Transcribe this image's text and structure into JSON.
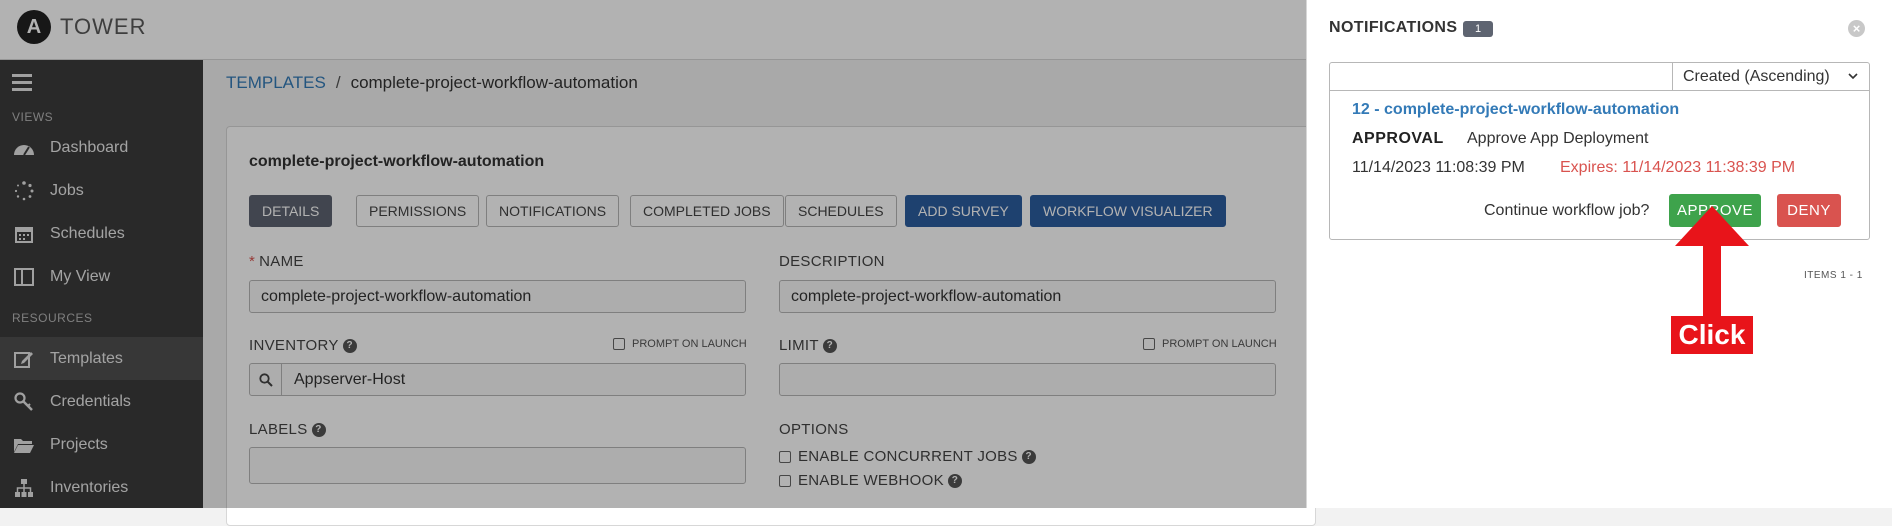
{
  "app": {
    "logo_letter": "A",
    "name": "TOWER"
  },
  "sidebar": {
    "sections": {
      "views": "VIEWS",
      "resources": "RESOURCES"
    },
    "items": [
      {
        "label": "Dashboard",
        "icon": "dashboard-icon"
      },
      {
        "label": "Jobs",
        "icon": "jobs-spinner-icon"
      },
      {
        "label": "Schedules",
        "icon": "calendar-icon"
      },
      {
        "label": "My View",
        "icon": "columns-icon"
      },
      {
        "label": "Templates",
        "icon": "pencil-square-icon",
        "active": true
      },
      {
        "label": "Credentials",
        "icon": "key-icon"
      },
      {
        "label": "Projects",
        "icon": "folder-icon"
      },
      {
        "label": "Inventories",
        "icon": "sitemap-icon"
      }
    ]
  },
  "breadcrumb": {
    "root": "TEMPLATES",
    "separator": "/",
    "current": "complete-project-workflow-automation"
  },
  "template": {
    "title": "complete-project-workflow-automation",
    "tabs": {
      "details": "DETAILS",
      "permissions": "PERMISSIONS",
      "notifications": "NOTIFICATIONS",
      "completed_jobs": "COMPLETED JOBS",
      "schedules": "SCHEDULES",
      "add_survey": "ADD SURVEY",
      "workflow_visualizer": "WORKFLOW VISUALIZER"
    },
    "fields": {
      "name_label": "NAME",
      "name_required": "*",
      "name_value": "complete-project-workflow-automation",
      "description_label": "DESCRIPTION",
      "description_value": "complete-project-workflow-automation",
      "inventory_label": "INVENTORY",
      "inventory_value": "Appserver-Host",
      "prompt_on_launch": "PROMPT ON LAUNCH",
      "limit_label": "LIMIT",
      "limit_value": "",
      "labels_label": "LABELS",
      "labels_value": "",
      "options_label": "OPTIONS",
      "option_concurrent": "ENABLE CONCURRENT JOBS",
      "option_webhook": "ENABLE WEBHOOK"
    }
  },
  "notifications": {
    "title": "NOTIFICATIONS",
    "count": "1",
    "sort": {
      "search_value": "",
      "selected": "Created (Ascending)"
    },
    "items": [
      {
        "job_link": "12 - complete-project-workflow-automation",
        "type_label": "APPROVAL",
        "name": "Approve App Deployment",
        "created": "11/14/2023 11:08:39 PM",
        "expires": "Expires: 11/14/2023 11:38:39 PM",
        "prompt": "Continue workflow job?",
        "approve_label": "APPROVE",
        "deny_label": "DENY"
      }
    ],
    "items_label": "ITEMS  1 - 1"
  },
  "annotation": {
    "label": "Click",
    "color": "#e8141a"
  },
  "colors": {
    "approve": "#3ea34c",
    "deny": "#d9534f",
    "link": "#337ab7",
    "primary_blue": "#2c5d9f",
    "sidebar": "#3b3b3b"
  }
}
